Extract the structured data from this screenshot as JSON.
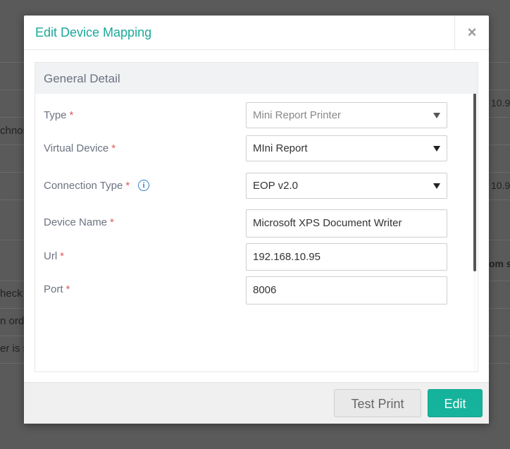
{
  "background": {
    "fragments_left": [
      "chnos",
      "heck",
      "n ord",
      "er is s"
    ],
    "fragments_right": [
      "10.9",
      "10.9",
      "om s"
    ]
  },
  "modal": {
    "title": "Edit Device Mapping",
    "close_label": "×",
    "section_title": "General Detail",
    "fields": [
      {
        "label": "Type",
        "required": "*",
        "value": "Mini Report Printer",
        "kind": "select",
        "disabled": true
      },
      {
        "label": "Virtual Device",
        "required": "*",
        "value": "MIni Report",
        "kind": "select"
      },
      {
        "label": "Connection Type",
        "required": "*",
        "value": "EOP v2.0",
        "kind": "select",
        "info": "i"
      },
      {
        "label": "Device Name",
        "required": "*",
        "value": "Microsoft XPS Document Writer",
        "kind": "text"
      },
      {
        "label": "Url",
        "required": "*",
        "value": "192.168.10.95",
        "kind": "text"
      },
      {
        "label": "Port",
        "required": "*",
        "value": "8006",
        "kind": "text"
      }
    ],
    "buttons": {
      "test_print": "Test Print",
      "edit": "Edit"
    }
  },
  "colors": {
    "accent": "#1aa99a",
    "primary_button": "#16b39c",
    "required": "#e05a5a",
    "info": "#2f7fc8"
  }
}
